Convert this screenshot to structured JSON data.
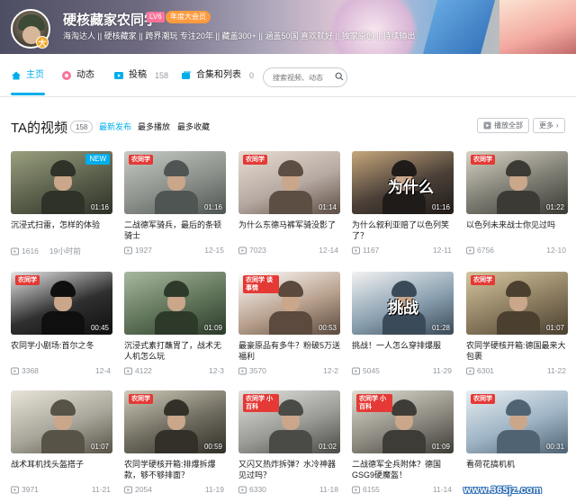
{
  "profile": {
    "name": "硬核藏家农同学",
    "level": "LV6",
    "vip": "年度大会员",
    "badge": "大",
    "sign": "海淘达人 || 硬核藏家 || 跨界潮玩 专注20年 || 藏盖300+ || 涵盖50国 喜欢就好 || 独家原创 || 持续输出"
  },
  "nav": {
    "home": "主页",
    "dynamic": "动态",
    "submit": "投稿",
    "submit_count": "158",
    "collection": "合集和列表",
    "collection_count": "0",
    "search_placeholder": "搜索视频、动态"
  },
  "section": {
    "title": "TA的视频",
    "count": "158",
    "sort_latest": "最新发布",
    "sort_most_play": "最多播放",
    "sort_most_fav": "最多收藏",
    "play_all": "播放全部",
    "more": "更多"
  },
  "colors": {
    "accent": "#00aeec",
    "pink": "#fb7299"
  },
  "videos": [
    {
      "title": "沉浸式扫雷，怎样的体验",
      "plays": "1616",
      "date": "19小时前",
      "duration": "01:16",
      "badge": "NEW",
      "overlay": ""
    },
    {
      "title": "二战德军骑兵，最后的条顿骑士",
      "plays": "1927",
      "date": "12-15",
      "duration": "01:16",
      "badge": "",
      "overlay": "农同学"
    },
    {
      "title": "为什么东德马裤军骑没影了",
      "plays": "7023",
      "date": "12-14",
      "duration": "01:14",
      "badge": "",
      "overlay": "农同学"
    },
    {
      "title": "为什么叙利亚赔了以色列笑了？",
      "plays": "1167",
      "date": "12-11",
      "duration": "01:16",
      "badge": "",
      "overlay": "为什么"
    },
    {
      "title": "以色列未来战士你见过吗",
      "plays": "6756",
      "date": "12-10",
      "duration": "01:22",
      "badge": "",
      "overlay": "农同学"
    },
    {
      "title": "农同学小剧场:首尔之冬",
      "plays": "3368",
      "date": "12-4",
      "duration": "00:45",
      "badge": "",
      "overlay": "农同学"
    },
    {
      "title": "沉浸式素打蘸胃了，战术无人机怎么玩",
      "plays": "4122",
      "date": "12-3",
      "duration": "01:09",
      "badge": "",
      "overlay": ""
    },
    {
      "title": "最豪原品有多牛？粉破5万送福利",
      "plays": "3570",
      "date": "12-2",
      "duration": "00:53",
      "badge": "",
      "overlay": "农同学 谈事情"
    },
    {
      "title": "挑战！一人怎么穿排爆服",
      "plays": "5045",
      "date": "11-29",
      "duration": "01:28",
      "badge": "",
      "overlay": "挑战"
    },
    {
      "title": "农同学硬核开箱:德国最来大包裹",
      "plays": "6301",
      "date": "11-22",
      "duration": "01:07",
      "badge": "",
      "overlay": "农同学"
    },
    {
      "title": "战术耳机找头盔搭子",
      "plays": "3971",
      "date": "11-21",
      "duration": "01:07",
      "badge": "",
      "overlay": ""
    },
    {
      "title": "农同学硬核开箱:排爆拆爆款，够不够排面？",
      "plays": "2054",
      "date": "11-19",
      "duration": "00:59",
      "badge": "",
      "overlay": "农同学"
    },
    {
      "title": "又闪又热炸拆弹？水冷神器见过吗？",
      "plays": "6330",
      "date": "11-18",
      "duration": "01:02",
      "badge": "",
      "overlay": "农同学 小百科"
    },
    {
      "title": "二战德军全兵附体？德国GSG9硬魔盔！",
      "plays": "6155",
      "date": "11-14",
      "duration": "01:09",
      "badge": "",
      "overlay": "农同学 小百科"
    },
    {
      "title": "看荷花搞机机",
      "plays": "",
      "date": "",
      "duration": "00:31",
      "badge": "",
      "overlay": "农同学"
    }
  ],
  "watermark": "www.365jz.com"
}
